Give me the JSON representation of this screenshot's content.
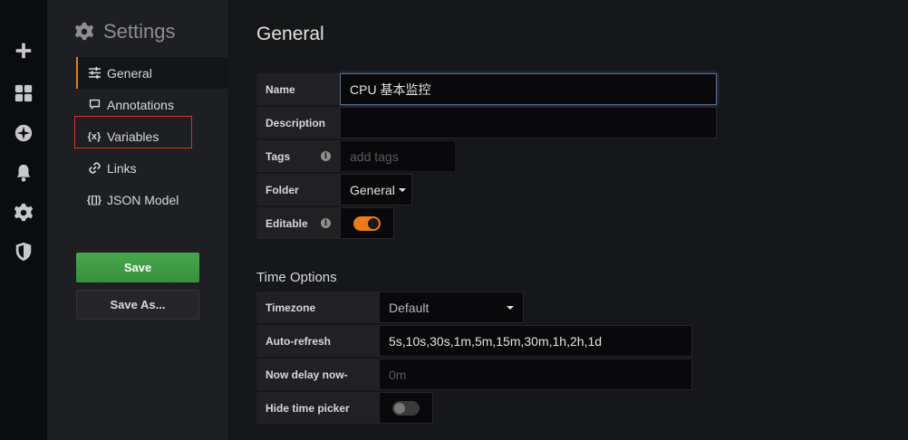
{
  "rail": {
    "icons": [
      "plus-icon",
      "dashboards-icon",
      "explore-compass-icon",
      "alerting-bell-icon",
      "configuration-gear-icon",
      "server-admin-shield-icon"
    ]
  },
  "sidebar": {
    "title": "Settings",
    "items": [
      {
        "label": "General",
        "icon": "sliders-icon",
        "active": true
      },
      {
        "label": "Annotations",
        "icon": "comment-icon",
        "active": false
      },
      {
        "label": "Variables",
        "icon": "variables-icon",
        "active": false
      },
      {
        "label": "Links",
        "icon": "link-icon",
        "active": false
      },
      {
        "label": "JSON Model",
        "icon": "json-brackets-icon",
        "active": false
      }
    ],
    "save_label": "Save",
    "save_as_label": "Save As..."
  },
  "general": {
    "heading": "General",
    "name_label": "Name",
    "name_value": "CPU 基本监控",
    "description_label": "Description",
    "description_value": "",
    "tags_label": "Tags",
    "tags_placeholder": "add tags",
    "folder_label": "Folder",
    "folder_value": "General",
    "editable_label": "Editable",
    "editable_on": true
  },
  "time_options": {
    "heading": "Time Options",
    "timezone_label": "Timezone",
    "timezone_value": "Default",
    "autorefresh_label": "Auto-refresh",
    "autorefresh_value": "5s,10s,30s,1m,5m,15m,30m,1h,2h,1d",
    "nowdelay_label": "Now delay now-",
    "nowdelay_placeholder": "0m",
    "hidepicker_label": "Hide time picker",
    "hidepicker_on": false
  },
  "colors": {
    "accent": "#eb7b18",
    "save_green": "#3f9d46",
    "highlight_red": "#e02f2f"
  }
}
